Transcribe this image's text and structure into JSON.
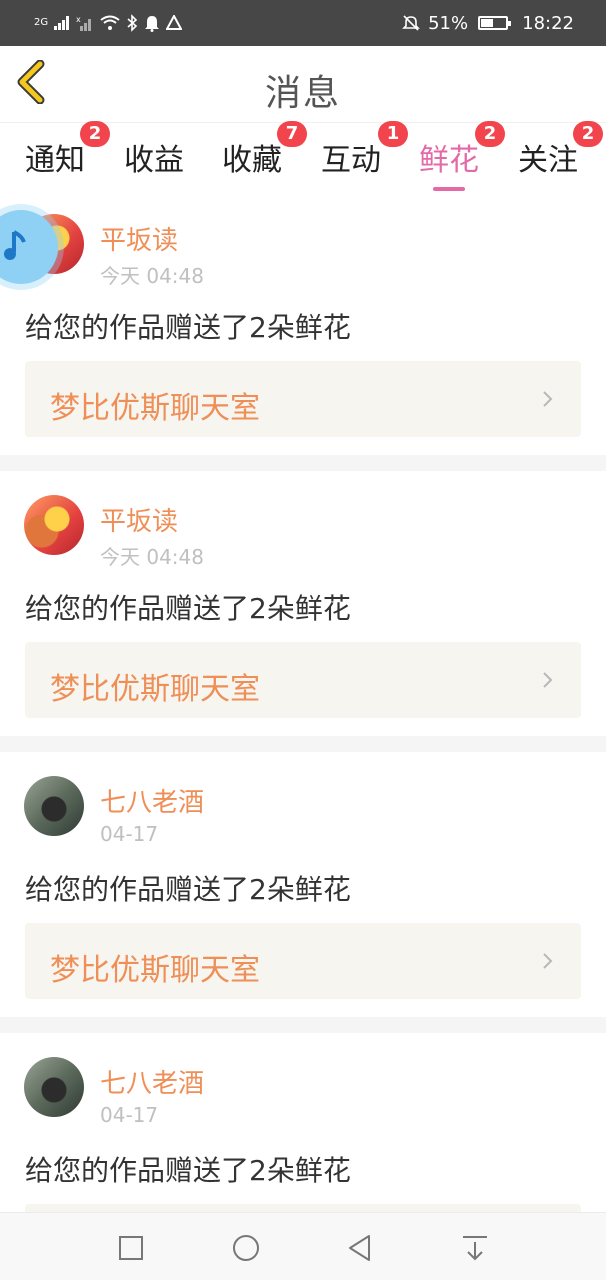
{
  "status_bar": {
    "network_label": "2G",
    "battery_percent": "51%",
    "battery_level": 0.51,
    "time": "18:22",
    "icons": [
      "signal-icon",
      "no-signal-icon",
      "wifi-icon",
      "bluetooth-icon",
      "notification-bell-icon",
      "alert-triangle-icon",
      "mute-icon",
      "battery-icon"
    ]
  },
  "header": {
    "title": "消息",
    "back_icon": "chevron-left-icon"
  },
  "tabs": [
    {
      "label": "通知",
      "badge": "2"
    },
    {
      "label": "收益",
      "badge": ""
    },
    {
      "label": "收藏",
      "badge": "7"
    },
    {
      "label": "互动",
      "badge": "1"
    },
    {
      "label": "鲜花",
      "badge": "2",
      "active": true
    },
    {
      "label": "关注",
      "badge": "2"
    }
  ],
  "messages": [
    {
      "user": "平坂读",
      "time": "今天 04:48",
      "text": "给您的作品赠送了2朵鲜花",
      "work": "梦比优斯聊天室"
    },
    {
      "user": "平坂读",
      "time": "今天 04:48",
      "text": "给您的作品赠送了2朵鲜花",
      "work": "梦比优斯聊天室"
    },
    {
      "user": "七八老酒",
      "time": "04-17",
      "text": "给您的作品赠送了2朵鲜花",
      "work": "梦比优斯聊天室"
    },
    {
      "user": "七八老酒",
      "time": "04-17",
      "text": "给您的作品赠送了2朵鲜花",
      "work": ""
    }
  ],
  "colors": {
    "accent": "#e36aa6",
    "username": "#ef8f57",
    "badge": "#f2444d",
    "status_bar": "#474747",
    "back_arrow": "#f5c81e"
  },
  "nav_bar": {
    "icons": [
      "recent-apps-icon",
      "home-icon",
      "back-icon",
      "notification-pull-icon"
    ]
  }
}
